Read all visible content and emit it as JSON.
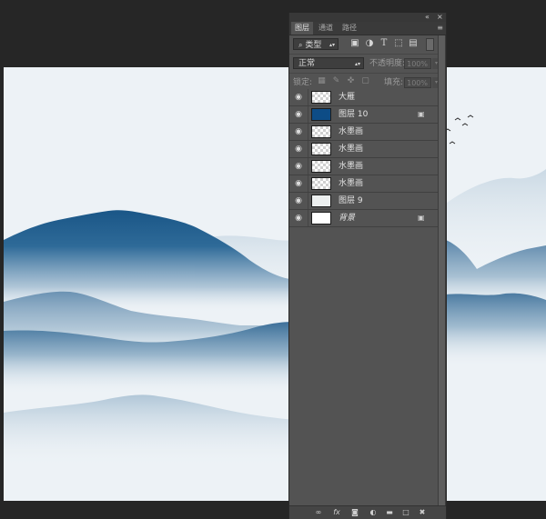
{
  "panel": {
    "collapse_glyph": "«",
    "close_glyph": "×",
    "tabs": [
      {
        "label": "图层",
        "active": true
      },
      {
        "label": "通道",
        "active": false
      },
      {
        "label": "路径",
        "active": false
      }
    ],
    "menu_glyph": "≡"
  },
  "filter": {
    "kind_label": "类型",
    "icons": [
      "image-filter-icon",
      "adjustment-filter-icon",
      "type-filter-icon",
      "shape-filter-icon",
      "smart-object-filter-icon"
    ]
  },
  "blend": {
    "mode": "正常",
    "opacity_label": "不透明度:",
    "opacity_value": "100%"
  },
  "lock": {
    "label": "锁定:",
    "fill_label": "填充:",
    "fill_value": "100%"
  },
  "layers": [
    {
      "name": "大雁",
      "thumb": "checker",
      "locked": false,
      "italic": false
    },
    {
      "name": "图层 10",
      "thumb": "blue",
      "locked": true,
      "italic": false
    },
    {
      "name": "水墨画",
      "thumb": "checker",
      "locked": false,
      "italic": false
    },
    {
      "name": "水墨画",
      "thumb": "checker",
      "locked": false,
      "italic": false
    },
    {
      "name": "水墨画",
      "thumb": "checker",
      "locked": false,
      "italic": false
    },
    {
      "name": "水墨画",
      "thumb": "checker",
      "locked": false,
      "italic": false
    },
    {
      "name": "图层 9",
      "thumb": "light",
      "locked": false,
      "italic": false
    },
    {
      "name": "背景",
      "thumb": "white",
      "locked": true,
      "italic": true
    }
  ],
  "bottom_icons": [
    "link-layers-icon",
    "fx-icon",
    "mask-icon",
    "adjustment-layer-icon",
    "group-folder-icon",
    "new-layer-icon",
    "delete-icon"
  ],
  "colors": {
    "mountain_dark": "#1e5a8a",
    "mountain_mid": "#5d88ac",
    "mist": "#edf2f6",
    "panel_bg": "#535353"
  }
}
